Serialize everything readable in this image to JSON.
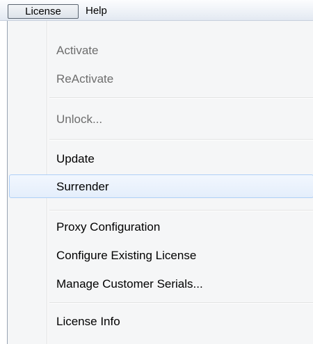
{
  "menubar": {
    "items": [
      {
        "label": "License"
      },
      {
        "label": "Help"
      }
    ]
  },
  "dropdown": {
    "items": [
      {
        "label": "Activate",
        "enabled": false
      },
      {
        "label": "ReActivate",
        "enabled": false
      },
      {
        "label": "Unlock...",
        "enabled": false
      },
      {
        "label": "Update",
        "enabled": true
      },
      {
        "label": "Surrender",
        "enabled": true,
        "highlighted": true
      },
      {
        "label": "Proxy Configuration",
        "enabled": true
      },
      {
        "label": "Configure Existing License",
        "enabled": true
      },
      {
        "label": "Manage Customer Serials...",
        "enabled": true
      },
      {
        "label": "License Info",
        "enabled": true
      }
    ]
  },
  "colors": {
    "highlight_border": "#aecff7",
    "disabled_text": "#6d6d6d",
    "menu_background": "#f5f6f7"
  }
}
